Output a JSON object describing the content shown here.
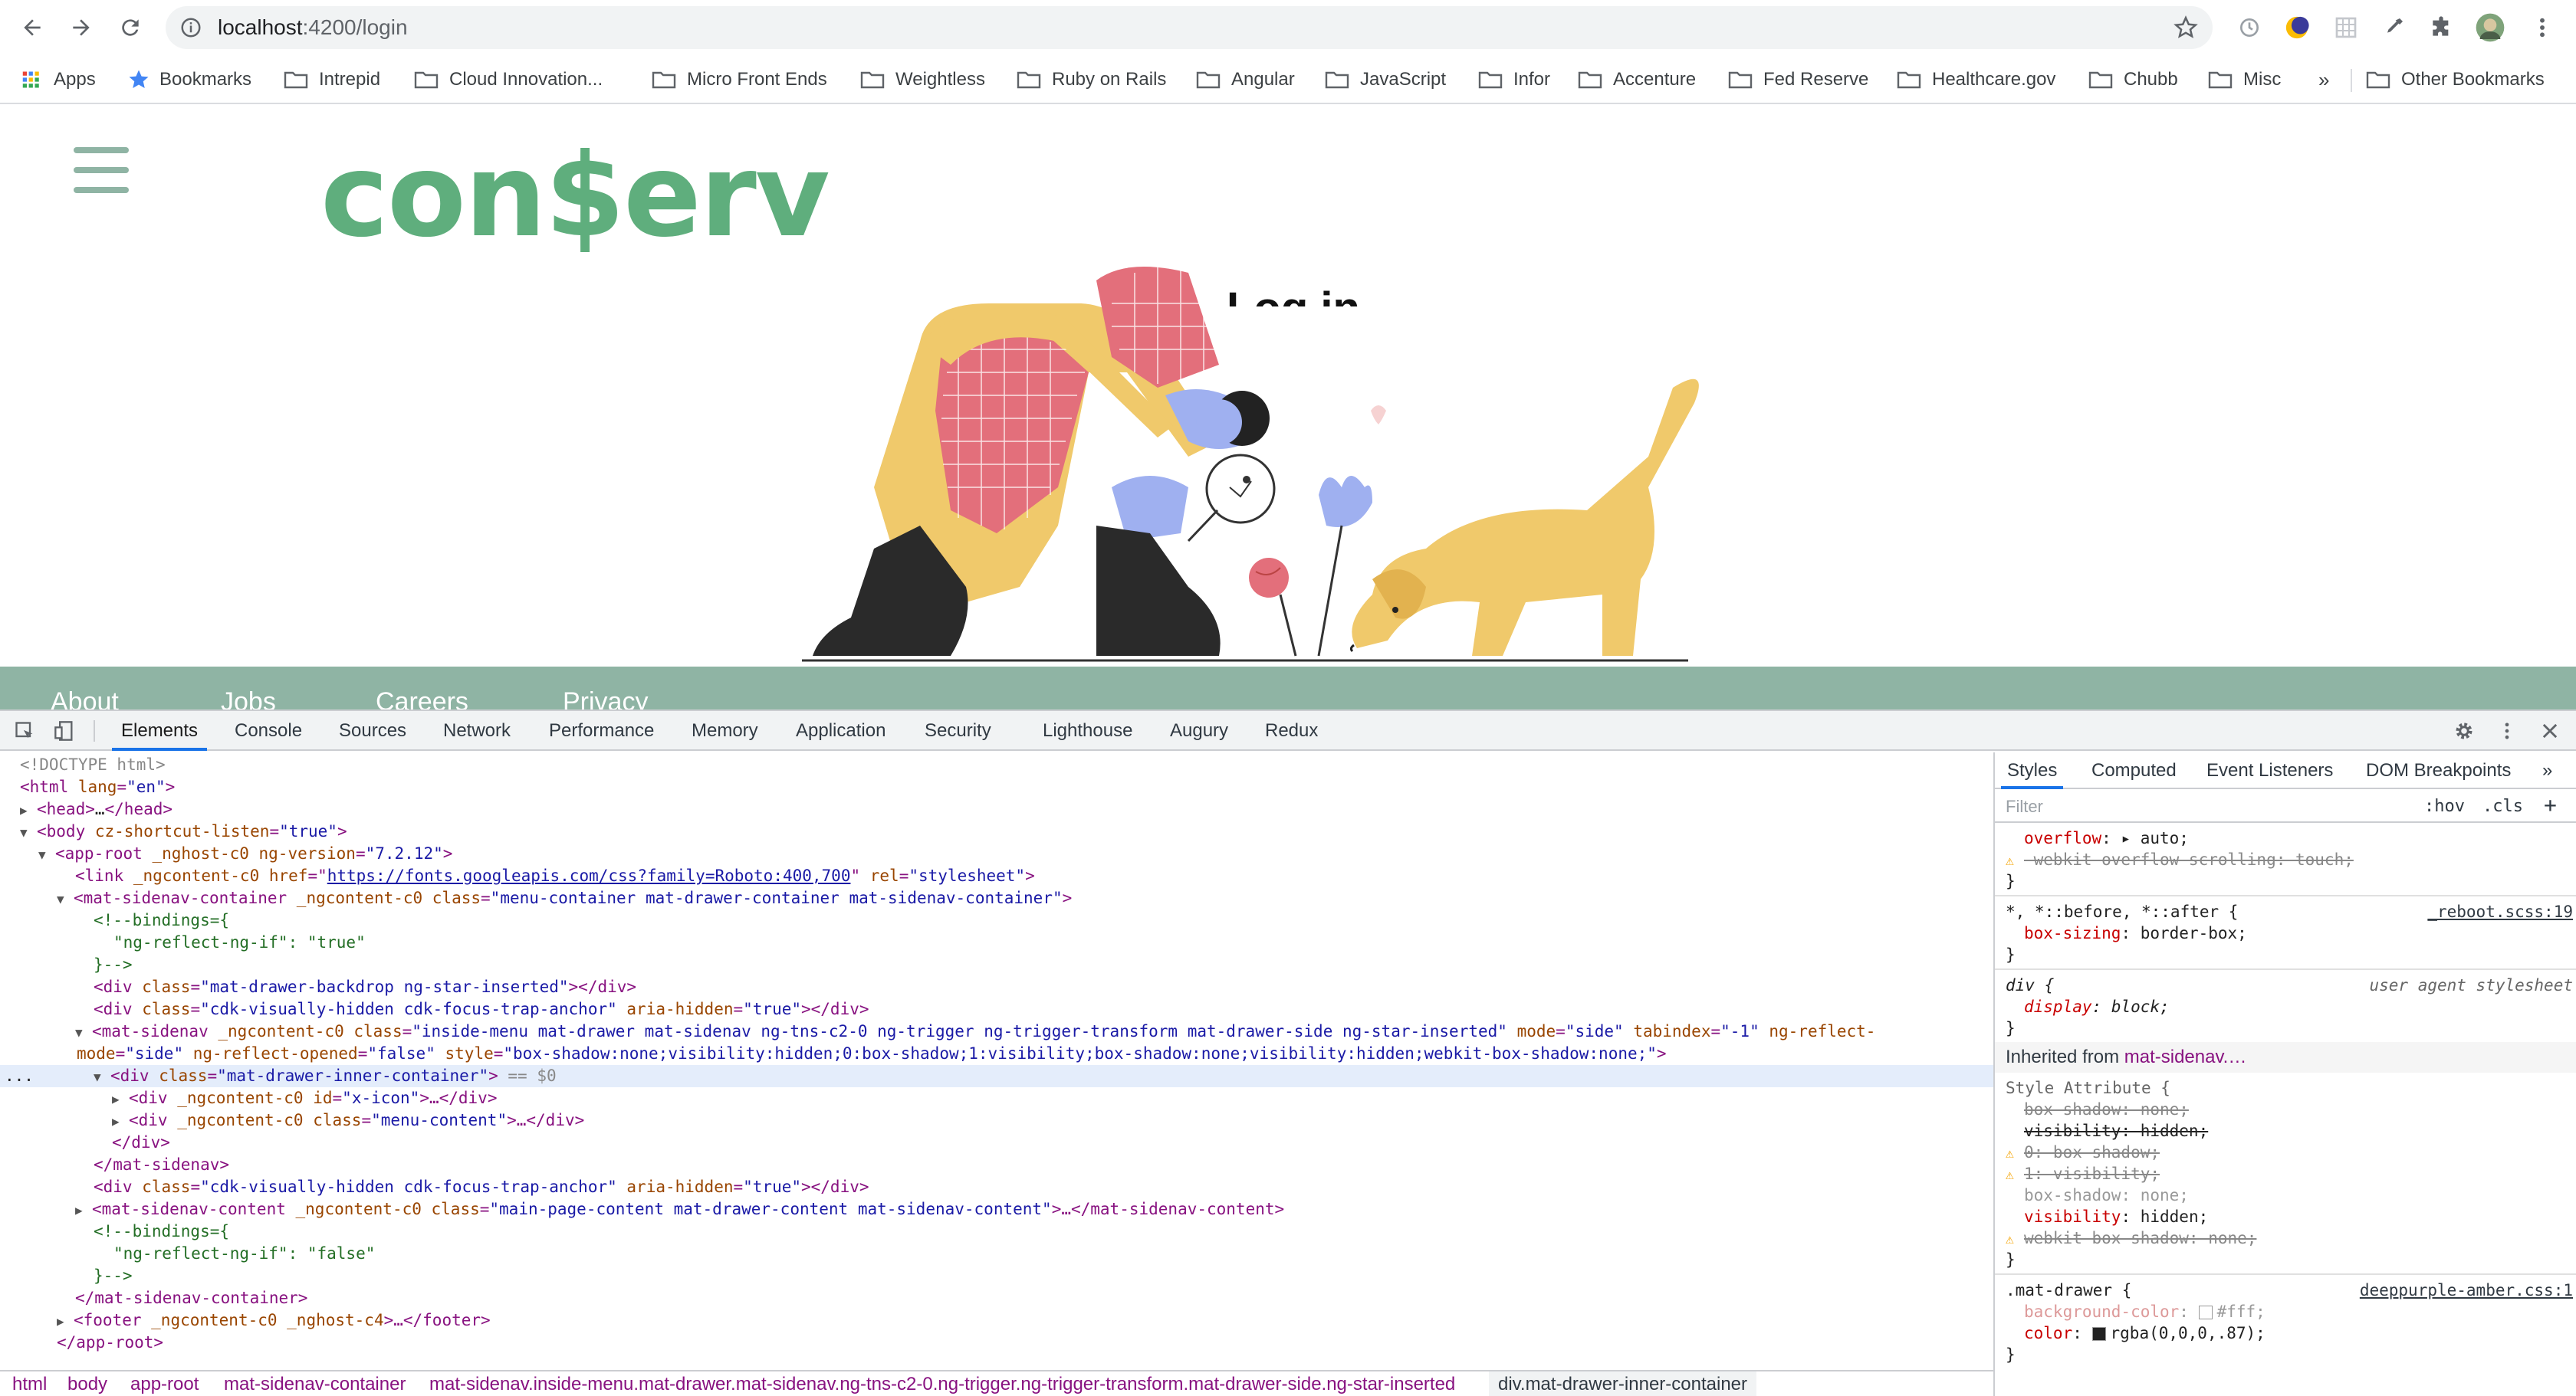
{
  "browser": {
    "url_host": "localhost",
    "url_path": ":4200/login"
  },
  "bookmarks": [
    {
      "label": "Apps",
      "icon": "apps-grid-icon"
    },
    {
      "label": "Bookmarks",
      "icon": "star-icon"
    },
    {
      "label": "Intrepid",
      "icon": "folder-icon"
    },
    {
      "label": "Cloud Innovation...",
      "icon": "folder-icon"
    },
    {
      "label": "Micro Front Ends",
      "icon": "folder-icon"
    },
    {
      "label": "Weightless",
      "icon": "folder-icon"
    },
    {
      "label": "Ruby on Rails",
      "icon": "folder-icon"
    },
    {
      "label": "Angular",
      "icon": "folder-icon"
    },
    {
      "label": "JavaScript",
      "icon": "folder-icon"
    },
    {
      "label": "Infor",
      "icon": "folder-icon"
    },
    {
      "label": "Accenture",
      "icon": "folder-icon"
    },
    {
      "label": "Fed Reserve",
      "icon": "folder-icon"
    },
    {
      "label": "Healthcare.gov",
      "icon": "folder-icon"
    },
    {
      "label": "Chubb",
      "icon": "folder-icon"
    },
    {
      "label": "Misc",
      "icon": "folder-icon"
    }
  ],
  "bookmarks_overflow": "»",
  "other_bookmarks": "Other Bookmarks",
  "page": {
    "logo_text": "con$erv",
    "login_heading": "Log in",
    "footer_links": [
      "About",
      "Jobs",
      "Careers",
      "Privacy"
    ],
    "colors": {
      "brand_green": "#5fae7d",
      "footer_green": "#8fb4a4"
    }
  },
  "devtools": {
    "tabs": [
      "Elements",
      "Console",
      "Sources",
      "Network",
      "Performance",
      "Memory",
      "Application",
      "Security",
      "Lighthouse",
      "Augury",
      "Redux"
    ],
    "active_tab": "Elements",
    "dom": {
      "l1": "<!DOCTYPE html>",
      "l2_tag": "<html ",
      "l2_attr": "lang",
      "l2_val": "\"en\"",
      "l2_end": ">",
      "l3_open": "<head>",
      "l3_dots": "…",
      "l3_close": "</head>",
      "l4_tag": "<body ",
      "l4_attr": "cz-shortcut-listen",
      "l4_val": "\"true\"",
      "l4_end": ">",
      "l5_tag": "<app-root ",
      "l5_attrs": "_nghost-c0 ng-version",
      "l5_val": "\"7.2.12\"",
      "l5_end": ">",
      "l6_tag": "<link ",
      "l6_a1": "_ngcontent-c0 href",
      "l6_href": "https://fonts.googleapis.com/css?family=Roboto:400,700",
      "l6_a2": "rel",
      "l6_v2": "\"stylesheet\"",
      "l6_end": ">",
      "l7_tag": "<mat-sidenav-container ",
      "l7_a1": "_ngcontent-c0 class",
      "l7_v1": "\"menu-container mat-drawer-container mat-sidenav-container\"",
      "l7_end": ">",
      "l8": "<!--bindings={",
      "l9": "\"ng-reflect-ng-if\": \"true\"",
      "l10": "}-->",
      "l11_tag": "<div ",
      "l11_a": "class",
      "l11_v": "\"mat-drawer-backdrop ng-star-inserted\"",
      "l11_end": "></div>",
      "l12_tag": "<div ",
      "l12_a": "class",
      "l12_v": "\"cdk-visually-hidden cdk-focus-trap-anchor\"",
      "l12_a2": "aria-hidden",
      "l12_v2": "\"true\"",
      "l12_end": "></div>",
      "l13_tag": "<mat-sidenav ",
      "l13_a1": "_ngcontent-c0 class",
      "l13_v1": "\"inside-menu mat-drawer mat-sidenav ng-tns-c2-0 ng-trigger ng-trigger-transform mat-drawer-side ng-star-inserted\"",
      "l13_a2": "mode",
      "l13_v2": "\"side\"",
      "l13_a3": "tabindex",
      "l13_v3": "\"-1\"",
      "l13_a4": "ng-reflect-",
      "l14_a1": "mode",
      "l14_v1": "\"side\"",
      "l14_a2": "ng-reflect-opened",
      "l14_v2": "\"false\"",
      "l14_a3": "style",
      "l14_v3": "\"box-shadow:none;visibility:hidden;0:box-shadow;1:visibility;box-shadow:none;visibility:hidden;webkit-box-shadow:none;\"",
      "l14_end": ">",
      "l15_dots": "...",
      "l15_tag": "<div ",
      "l15_a": "class",
      "l15_v": "\"mat-drawer-inner-container\"",
      "l15_end": ">",
      "l15_eq": " == $0",
      "l16_tag": "<div ",
      "l16_a": "_ngcontent-c0 id",
      "l16_v": "\"x-icon\"",
      "l16_end": ">…</div>",
      "l17_tag": "<div ",
      "l17_a": "_ngcontent-c0 class",
      "l17_v": "\"menu-content\"",
      "l17_end": ">…</div>",
      "l18": "</div>",
      "l19": "</mat-sidenav>",
      "l20_tag": "<div ",
      "l20_a": "class",
      "l20_v": "\"cdk-visually-hidden cdk-focus-trap-anchor\"",
      "l20_a2": "aria-hidden",
      "l20_v2": "\"true\"",
      "l20_end": "></div>",
      "l21_tag": "<mat-sidenav-content ",
      "l21_a": "_ngcontent-c0 class",
      "l21_v": "\"main-page-content mat-drawer-content mat-sidenav-content\"",
      "l21_end": ">…</mat-sidenav-content>",
      "l22": "<!--bindings={",
      "l23": "\"ng-reflect-ng-if\": \"false\"",
      "l24": "}-->",
      "l25": "</mat-sidenav-container>",
      "l26_tag": "<footer ",
      "l26_a": "_ngcontent-c0 _nghost-c4",
      "l26_end": ">…</footer>",
      "l27": "</app-root>"
    },
    "breadcrumbs": [
      "html",
      "body",
      "app-root",
      "mat-sidenav-container",
      "mat-sidenav.inside-menu.mat-drawer.mat-sidenav.ng-tns-c2-0.ng-trigger.ng-trigger-transform.mat-drawer-side.ng-star-inserted",
      "div.mat-drawer-inner-container"
    ],
    "styles_tabs": [
      "Styles",
      "Computed",
      "Event Listeners",
      "DOM Breakpoints"
    ],
    "styles_more": "»",
    "filter_placeholder": "Filter",
    "filter_hov": ":hov",
    "filter_cls": ".cls",
    "styles": {
      "s1_prop": "overflow",
      "s1_val": "auto;",
      "s2": "-webkit-overflow-scrolling: touch;",
      "brace_close": "}",
      "r2_sel": "*, *::before, *::after {",
      "r2_src": "_reboot.scss:19",
      "r2_prop": "box-sizing",
      "r2_val": "border-box;",
      "r3_sel": "div {",
      "r3_src": "user agent stylesheet",
      "r3_prop": "display",
      "r3_val": "block;",
      "inherited_label": "Inherited from ",
      "inherited_from": "mat-sidenav.…",
      "style_attr": "Style Attribute {",
      "sa1": "box-shadow: none;",
      "sa2": "visibility: hidden;",
      "sa3": "0: box-shadow;",
      "sa4": "1: visibility;",
      "sa5_prop": "box-shadow",
      "sa5_val": "none;",
      "sa6_prop": "visibility",
      "sa6_val": "hidden;",
      "sa7": "webkit-box-shadow: none;",
      "r5_sel": ".mat-drawer {",
      "r5_src": "deeppurple-amber.css:1",
      "r5_p1": "background-color",
      "r5_v1": "#fff;",
      "r5_p2": "color",
      "r5_v2": "rgba(0,0,0,.87);"
    }
  }
}
